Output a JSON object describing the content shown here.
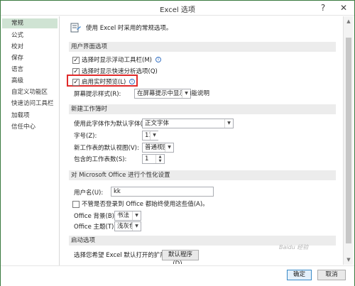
{
  "window": {
    "title": "Excel 选项",
    "help_glyph": "?",
    "close_glyph": "✕"
  },
  "sidebar": {
    "items": [
      {
        "label": "常规",
        "active": true
      },
      {
        "label": "公式"
      },
      {
        "label": "校对"
      },
      {
        "label": "保存"
      },
      {
        "label": "语言"
      },
      {
        "label": "高级"
      },
      {
        "label": "自定义功能区"
      },
      {
        "label": "快速访问工具栏"
      },
      {
        "label": "加载项"
      },
      {
        "label": "信任中心"
      }
    ]
  },
  "intro": {
    "text": "使用 Excel 时采用的常规选项。"
  },
  "ui_options": {
    "header": "用户界面选项",
    "mini_toolbar": {
      "label": "选择时显示浮动工具栏(M)",
      "checked": true
    },
    "quick_analysis": {
      "label": "选择时显示快速分析选项(Q)",
      "checked": true
    },
    "live_preview": {
      "label": "启用实时预览(L)",
      "checked": true
    },
    "info_glyph": "i",
    "screentip_label": "屏幕提示样式(R):",
    "screentip_value": "在屏幕提示中显示功能说明"
  },
  "new_workbook": {
    "header": "新建工作簿时",
    "font_label": "使用此字体作为默认字体(N):",
    "font_value": "正文字体",
    "size_label": "字号(Z):",
    "size_value": "11",
    "view_label": "新工作表的默认视图(V):",
    "view_value": "普通视图",
    "sheets_label": "包含的工作表数(S):",
    "sheets_value": "1"
  },
  "personalize": {
    "header": "对 Microsoft Office 进行个性化设置",
    "username_label": "用户名(U):",
    "username_value": "kk",
    "always_use_label": "不管是否登录到 Office 都始终使用这些值(A)。",
    "always_use_checked": false,
    "background_label": "Office 背景(B):",
    "background_value": "书法",
    "theme_label": "Office 主题(T):",
    "theme_value": "浅灰色"
  },
  "startup": {
    "header": "启动选项",
    "extensions_label": "选择您希望 Excel 默认打开的扩展名:",
    "default_programs_button": "默认程序(D)..."
  },
  "footer": {
    "ok": "确定",
    "cancel": "取消",
    "watermark": "Baidu 经验"
  },
  "colors": {
    "accent": "#3a7a3f",
    "sidebar_active": "#cfe3d3",
    "highlight": "#e02a2a"
  }
}
